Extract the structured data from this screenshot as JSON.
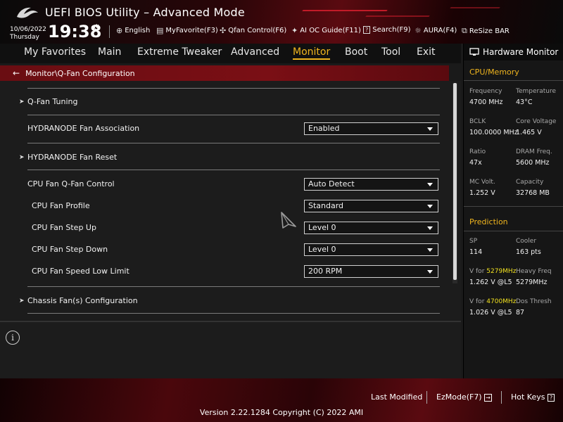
{
  "header": {
    "app_title": "UEFI BIOS Utility – Advanced Mode",
    "date": "10/06/2022",
    "day": "Thursday",
    "time": "19:38",
    "items": [
      {
        "icon": "globe-icon",
        "label": "English"
      },
      {
        "icon": "myfavorite-icon",
        "label": "MyFavorite(F3)"
      },
      {
        "icon": "fan-icon",
        "label": "Qfan Control(F6)"
      },
      {
        "icon": "lightbulb-icon",
        "label": "AI OC Guide(F11)"
      },
      {
        "icon": "search-question-icon",
        "label": "Search(F9)"
      },
      {
        "icon": "aura-icon",
        "label": "AURA(F4)"
      },
      {
        "icon": "resize-bar-icon",
        "label": "ReSize BAR"
      }
    ]
  },
  "menu": {
    "tabs": [
      "My Favorites",
      "Main",
      "Extreme Tweaker",
      "Advanced",
      "Monitor",
      "Boot",
      "Tool",
      "Exit"
    ],
    "active": "Monitor"
  },
  "breadcrumb": "Monitor\\Q-Fan Configuration",
  "settings": {
    "qfan_tuning": "Q-Fan Tuning",
    "hydranode_assoc": {
      "label": "HYDRANODE Fan Association",
      "value": "Enabled"
    },
    "hydranode_reset": "HYDRANODE Fan Reset",
    "cpu_qfan_control": {
      "label": "CPU Fan Q-Fan Control",
      "value": "Auto Detect"
    },
    "cpu_fan_profile": {
      "label": "CPU Fan Profile",
      "value": "Standard"
    },
    "cpu_fan_step_up": {
      "label": "CPU Fan Step Up",
      "value": "Level 0"
    },
    "cpu_fan_step_down": {
      "label": "CPU Fan Step Down",
      "value": "Level 0"
    },
    "cpu_fan_speed_low": {
      "label": "CPU Fan Speed Low Limit",
      "value": "200 RPM"
    },
    "chassis_fans": "Chassis Fan(s) Configuration"
  },
  "hardware_monitor": {
    "title": "Hardware Monitor",
    "cpu_memory": {
      "title": "CPU/Memory",
      "frequency": {
        "label": "Frequency",
        "value": "4700 MHz"
      },
      "temperature": {
        "label": "Temperature",
        "value": "43°C"
      },
      "bclk": {
        "label": "BCLK",
        "value": "100.0000 MHz"
      },
      "core_voltage": {
        "label": "Core Voltage",
        "value": "1.465 V"
      },
      "ratio": {
        "label": "Ratio",
        "value": "47x"
      },
      "dram_freq": {
        "label": "DRAM Freq.",
        "value": "5600 MHz"
      },
      "mc_volt": {
        "label": "MC Volt.",
        "value": "1.252 V"
      },
      "capacity": {
        "label": "Capacity",
        "value": "32768 MB"
      }
    },
    "prediction": {
      "title": "Prediction",
      "sp": {
        "label": "SP",
        "value": "114"
      },
      "cooler": {
        "label": "Cooler",
        "value": "163 pts"
      },
      "v_for_1": {
        "prefix": "V for ",
        "freq": "5279MHz",
        "value": "1.262 V @L5"
      },
      "heavy_freq": {
        "label": "Heavy Freq",
        "value": "5279MHz"
      },
      "v_for_2": {
        "prefix": "V for ",
        "freq": "4700MHz",
        "value": "1.026 V @L5"
      },
      "dos_thresh": {
        "label": "Dos Thresh",
        "value": "87"
      }
    }
  },
  "footer": {
    "last_modified": "Last Modified",
    "ezmode": "EzMode(F7)",
    "hot_keys": "Hot Keys",
    "version": "Version 2.22.1284 Copyright (C) 2022 AMI"
  },
  "colors": {
    "accent": "#f0b51e",
    "brand_red": "#c21b28",
    "highlight_yellow": "#f0e020"
  }
}
